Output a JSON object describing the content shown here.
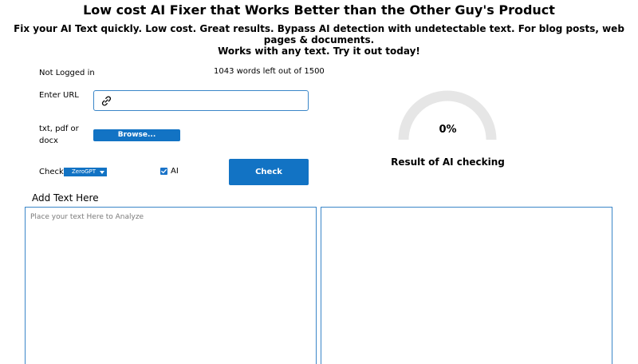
{
  "header": {
    "title": "Low cost AI Fixer that Works Better than the Other Guy's Product",
    "subtitle_line1": "Fix your AI Text quickly. Low cost. Great results. Bypass AI detection with undetectable text. For blog posts, web pages & documents.",
    "subtitle_line2": "Works with any text. Try it out today!"
  },
  "account": {
    "status": "Not Logged in",
    "words_left": "1043 words left out of 1500"
  },
  "url_field": {
    "label": "Enter URL",
    "value": "",
    "icon": "link-icon"
  },
  "file_upload": {
    "label_line1": "txt, pdf or",
    "label_line2": "docx",
    "button_label": "Browse..."
  },
  "check_options": {
    "label": "Check",
    "selected": "ZeroGPT",
    "ai_checkbox_label": "AI",
    "ai_checked": true
  },
  "check_button": {
    "label": "Check"
  },
  "result": {
    "gauge_value": "0%",
    "gauge_fraction": 0,
    "caption": "Result of AI checking",
    "colors": {
      "track": "#e6e6e6",
      "fill": "#1273c4"
    }
  },
  "editor": {
    "heading": "Add Text Here",
    "input_placeholder": "Place your text Here to Analyze",
    "input_value": "",
    "output_value": ""
  },
  "colors": {
    "accent": "#1273c4",
    "border": "#3a86c8"
  }
}
